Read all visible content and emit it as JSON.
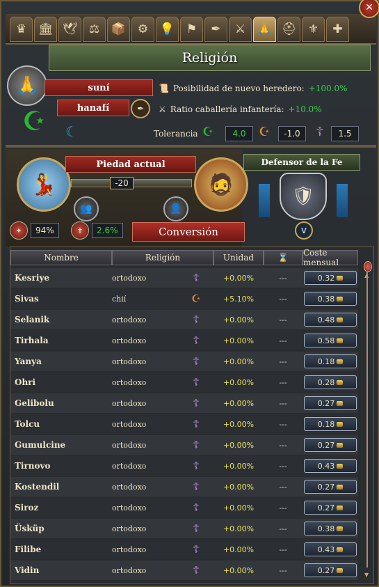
{
  "window": {
    "title": "Religión",
    "close_glyph": "✕"
  },
  "tabs": [
    {
      "icon": "crown-icon",
      "glyph": "♛",
      "active": false
    },
    {
      "icon": "courthouse-icon",
      "glyph": "🏛",
      "active": false
    },
    {
      "icon": "dove-icon",
      "glyph": "🕊",
      "active": false
    },
    {
      "icon": "merchants-icon",
      "glyph": "⚖",
      "active": false
    },
    {
      "icon": "goods-icon",
      "glyph": "📦",
      "active": false
    },
    {
      "icon": "gears-icon",
      "glyph": "⚙",
      "active": false
    },
    {
      "icon": "lightbulb-icon",
      "glyph": "💡",
      "active": false
    },
    {
      "icon": "flag-icon",
      "glyph": "⚑",
      "active": false
    },
    {
      "icon": "quill-icon",
      "glyph": "✒",
      "active": false
    },
    {
      "icon": "army-icon",
      "glyph": "⚔",
      "active": false
    },
    {
      "icon": "praying-hands-icon",
      "glyph": "🙏",
      "active": true
    },
    {
      "icon": "helmet-icon",
      "glyph": "⛑",
      "active": false
    },
    {
      "icon": "estates-icon",
      "glyph": "⚜",
      "active": false
    },
    {
      "icon": "decisions-icon",
      "glyph": "✚",
      "active": false
    }
  ],
  "religion": {
    "name": "suní",
    "school": "hanafí",
    "modifiers": [
      {
        "label": "Posibilidad de nuevo heredero:",
        "value": "+100.0%"
      },
      {
        "label": "Ratio caballería infantería:",
        "value": "+10.0%"
      }
    ],
    "tolerance": {
      "label": "Tolerancia",
      "true_faith": "4.0",
      "heretic": "-1.0",
      "heathen": "1.5"
    }
  },
  "piety": {
    "title": "Piedad actual",
    "value": "-20",
    "level": -0.2
  },
  "defender": {
    "title": "Defensor de la Fe",
    "badge": "V"
  },
  "stats": {
    "unity": "94%",
    "conversion_rate": "2.6%"
  },
  "conversion_button": "Conversión",
  "table": {
    "headers": [
      "Nombre",
      "Religión",
      "Unidad",
      "⌛",
      "Coste mensual"
    ],
    "rows": [
      {
        "name": "Kesriye",
        "religion": "ortodoxo",
        "icon": "orthodox-cross-icon",
        "unity": "+0.00%",
        "time": "---",
        "cost": "0.32"
      },
      {
        "name": "Sivas",
        "religion": "chií",
        "icon": "shia-crescent-icon",
        "unity": "+5.10%",
        "time": "---",
        "cost": "0.38"
      },
      {
        "name": "Selanik",
        "religion": "ortodoxo",
        "icon": "orthodox-cross-icon",
        "unity": "+0.00%",
        "time": "---",
        "cost": "0.48"
      },
      {
        "name": "Tirhala",
        "religion": "ortodoxo",
        "icon": "orthodox-cross-icon",
        "unity": "+0.00%",
        "time": "---",
        "cost": "0.58"
      },
      {
        "name": "Yanya",
        "religion": "ortodoxo",
        "icon": "orthodox-cross-icon",
        "unity": "+0.00%",
        "time": "---",
        "cost": "0.18"
      },
      {
        "name": "Ohri",
        "religion": "ortodoxo",
        "icon": "orthodox-cross-icon",
        "unity": "+0.00%",
        "time": "---",
        "cost": "0.28"
      },
      {
        "name": "Gelibolu",
        "religion": "ortodoxo",
        "icon": "orthodox-cross-icon",
        "unity": "+0.00%",
        "time": "---",
        "cost": "0.27"
      },
      {
        "name": "Tolcu",
        "religion": "ortodoxo",
        "icon": "orthodox-cross-icon",
        "unity": "+0.00%",
        "time": "---",
        "cost": "0.18"
      },
      {
        "name": "Gumulcine",
        "religion": "ortodoxo",
        "icon": "orthodox-cross-icon",
        "unity": "+0.00%",
        "time": "---",
        "cost": "0.27"
      },
      {
        "name": "Tirnovo",
        "religion": "ortodoxo",
        "icon": "orthodox-cross-icon",
        "unity": "+0.00%",
        "time": "---",
        "cost": "0.43"
      },
      {
        "name": "Kostendil",
        "religion": "ortodoxo",
        "icon": "orthodox-cross-icon",
        "unity": "+0.00%",
        "time": "---",
        "cost": "0.27"
      },
      {
        "name": "Siroz",
        "religion": "ortodoxo",
        "icon": "orthodox-cross-icon",
        "unity": "+0.00%",
        "time": "---",
        "cost": "0.27"
      },
      {
        "name": "Üsküp",
        "religion": "ortodoxo",
        "icon": "orthodox-cross-icon",
        "unity": "+0.00%",
        "time": "---",
        "cost": "0.38"
      },
      {
        "name": "Filibe",
        "religion": "ortodoxo",
        "icon": "orthodox-cross-icon",
        "unity": "+0.00%",
        "time": "---",
        "cost": "0.43"
      },
      {
        "name": "Vidin",
        "religion": "ortodoxo",
        "icon": "orthodox-cross-icon",
        "unity": "+0.00%",
        "time": "---",
        "cost": "0.27"
      }
    ]
  },
  "colors": {
    "accent_green": "#3ad14a",
    "unity_yellow": "#e8e060",
    "ribbon_red": "#9e2a22",
    "orthodox_purple": "#b58ad8",
    "shia_orange": "#e08a2a"
  }
}
